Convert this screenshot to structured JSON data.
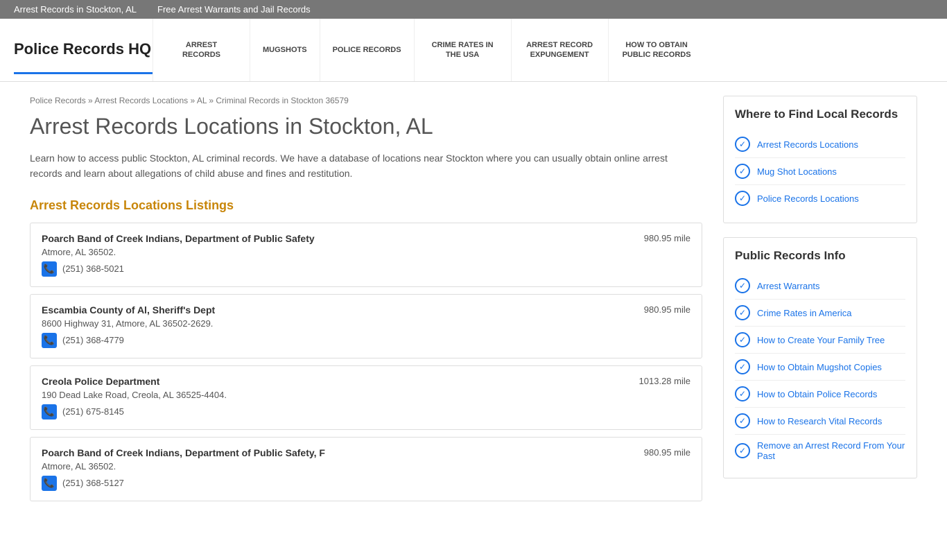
{
  "topbar": {
    "links": [
      {
        "label": "Arrest Records in Stockton, AL",
        "href": "#"
      },
      {
        "label": "Free Arrest Warrants and Jail Records",
        "href": "#"
      }
    ]
  },
  "header": {
    "logo": "Police Records HQ",
    "nav": [
      {
        "label": "ARREST RECORDS",
        "href": "#"
      },
      {
        "label": "MUGSHOTS",
        "href": "#"
      },
      {
        "label": "POLICE RECORDS",
        "href": "#"
      },
      {
        "label": "CRIME RATES IN THE USA",
        "href": "#"
      },
      {
        "label": "ARREST RECORD EXPUNGEMENT",
        "href": "#"
      },
      {
        "label": "HOW TO OBTAIN PUBLIC RECORDS",
        "href": "#"
      }
    ]
  },
  "breadcrumb": {
    "items": [
      {
        "label": "Police Records",
        "href": "#"
      },
      {
        "label": "Arrest Records Locations",
        "href": "#"
      },
      {
        "label": "AL",
        "href": "#"
      },
      {
        "label": "Criminal Records in Stockton 36579",
        "href": "#"
      }
    ]
  },
  "content": {
    "page_title": "Arrest Records Locations in Stockton, AL",
    "description": "Learn how to access public Stockton, AL criminal records. We have a database of locations near Stockton where you can usually obtain online arrest records and learn about allegations of child abuse and fines and restitution.",
    "section_heading": "Arrest Records Locations Listings",
    "listings": [
      {
        "name": "Poarch Band of Creek Indians, Department of Public Safety",
        "address": "Atmore, AL 36502.",
        "phone": "(251) 368-5021",
        "distance": "980.95 mile"
      },
      {
        "name": "Escambia County of Al, Sheriff's Dept",
        "address": "8600 Highway 31, Atmore, AL 36502-2629.",
        "phone": "(251) 368-4779",
        "distance": "980.95 mile"
      },
      {
        "name": "Creola Police Department",
        "address": "190 Dead Lake Road, Creola, AL 36525-4404.",
        "phone": "(251) 675-8145",
        "distance": "1013.28 mile"
      },
      {
        "name": "Poarch Band of Creek Indians, Department of Public Safety, F",
        "address": "Atmore, AL 36502.",
        "phone": "(251) 368-5127",
        "distance": "980.95 mile"
      }
    ]
  },
  "sidebar": {
    "local_records": {
      "title": "Where to Find Local Records",
      "links": [
        {
          "label": "Arrest Records Locations",
          "href": "#"
        },
        {
          "label": "Mug Shot Locations",
          "href": "#"
        },
        {
          "label": "Police Records Locations",
          "href": "#"
        }
      ]
    },
    "public_records": {
      "title": "Public Records Info",
      "links": [
        {
          "label": "Arrest Warrants",
          "href": "#"
        },
        {
          "label": "Crime Rates in America",
          "href": "#"
        },
        {
          "label": "How to Create Your Family Tree",
          "href": "#"
        },
        {
          "label": "How to Obtain Mugshot Copies",
          "href": "#"
        },
        {
          "label": "How to Obtain Police Records",
          "href": "#"
        },
        {
          "label": "How to Research Vital Records",
          "href": "#"
        },
        {
          "label": "Remove an Arrest Record From Your Past",
          "href": "#"
        }
      ]
    }
  }
}
